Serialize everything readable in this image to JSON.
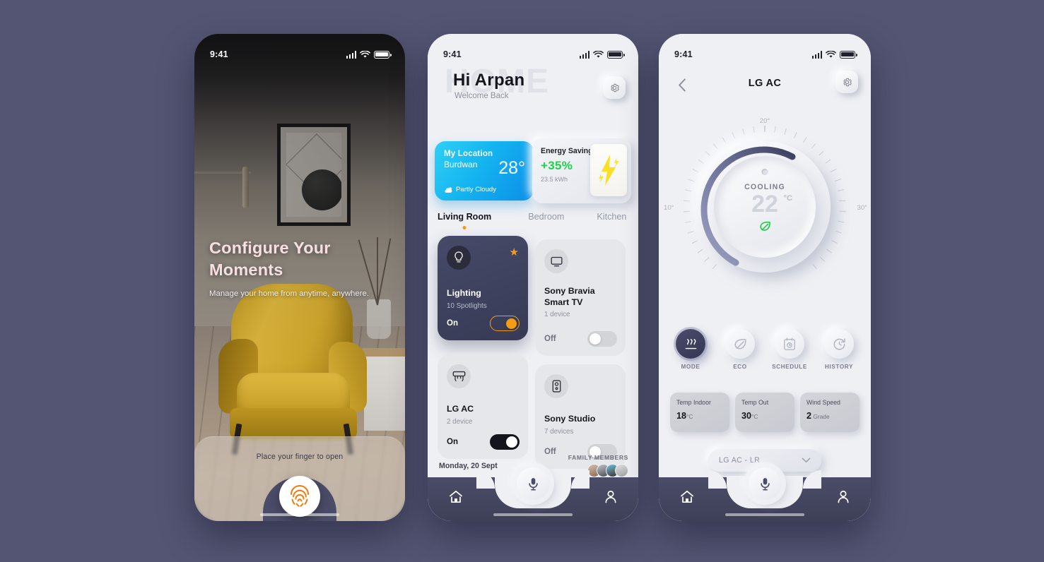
{
  "theme": {
    "background": "#535573",
    "accent_orange": "#f59c13",
    "accent_green": "#1ed14b",
    "dark_card": "#3d4059"
  },
  "screen1": {
    "statusbar": {
      "time": "9:41",
      "signal_icon": "signal-bars-icon",
      "wifi_icon": "wifi-icon",
      "battery_icon": "battery-icon"
    },
    "headline": "Configure Your Moments",
    "subtext": "Manage your home from anytime, anywhere.",
    "unlock": {
      "label": "Place your finger to open",
      "icon": "fingerprint-icon"
    }
  },
  "screen2": {
    "statusbar": {
      "time": "9:41"
    },
    "header": {
      "watermark": "HOME",
      "greeting": "Hi Arpan",
      "subtitle": "Welcome Back",
      "settings_icon": "gear-icon"
    },
    "weather": {
      "title": "My Location",
      "city": "Burdwan",
      "temperature": "28°",
      "condition": "Partly Cloudy",
      "icon": "cloud-icon"
    },
    "energy": {
      "title": "Energy Saving",
      "percent": "+35%",
      "usage": "23.5 kWh",
      "icon": "lightning-bolt-icon"
    },
    "room_tabs": [
      {
        "label": "Living Room",
        "active": true
      },
      {
        "label": "Bedroom",
        "active": false
      },
      {
        "label": "Kitchen",
        "active": false
      }
    ],
    "devices": [
      {
        "name": "Lighting",
        "count": "10 Spotlights",
        "state": "On",
        "on": true,
        "icon": "lightbulb-icon",
        "favorite": true
      },
      {
        "name": "Sony Bravia Smart TV",
        "count": "1 device",
        "state": "Off",
        "on": false,
        "icon": "tv-icon",
        "favorite": false
      },
      {
        "name": "LG AC",
        "count": "2 device",
        "state": "On",
        "on": true,
        "icon": "air-conditioner-icon",
        "favorite": false
      },
      {
        "name": "Sony Studio",
        "count": "7 devices",
        "state": "Off",
        "on": false,
        "icon": "speaker-icon",
        "favorite": false
      }
    ],
    "date": "Monday, 20 Sept",
    "family": {
      "label": "FAMILY MEMBERS",
      "count": 4
    },
    "bottom_nav": [
      {
        "name": "home",
        "icon": "home-icon"
      },
      {
        "name": "voice",
        "icon": "microphone-icon"
      },
      {
        "name": "profile",
        "icon": "user-icon"
      }
    ]
  },
  "screen3": {
    "statusbar": {
      "time": "9:41"
    },
    "header": {
      "title": "LG AC",
      "back_icon": "chevron-left-icon",
      "settings_icon": "gear-icon"
    },
    "dial": {
      "mode": "COOLING",
      "temperature": "22",
      "unit": "°C",
      "min_label": "10°",
      "mid_label": "20°",
      "max_label": "30°",
      "eco_icon": "leaf-icon"
    },
    "modes": [
      {
        "label": "MODE",
        "icon": "heat-waves-icon",
        "active": true
      },
      {
        "label": "ECO",
        "icon": "leaf-icon",
        "active": false
      },
      {
        "label": "SCHEDULE",
        "icon": "calendar-clock-icon",
        "active": false
      },
      {
        "label": "HISTORY",
        "icon": "history-icon",
        "active": false
      }
    ],
    "stats": [
      {
        "key": "Temp Indoor",
        "value": "18",
        "unit": "°C"
      },
      {
        "key": "Temp Out",
        "value": "30",
        "unit": "°C"
      },
      {
        "key": "Wind Speed",
        "value": "2",
        "unit": "Grade"
      }
    ],
    "selector": {
      "value": "LG AC - LR",
      "icon": "chevron-down-icon"
    },
    "bottom_nav": [
      {
        "name": "home",
        "icon": "home-icon"
      },
      {
        "name": "voice",
        "icon": "microphone-icon"
      },
      {
        "name": "profile",
        "icon": "user-icon"
      }
    ]
  }
}
